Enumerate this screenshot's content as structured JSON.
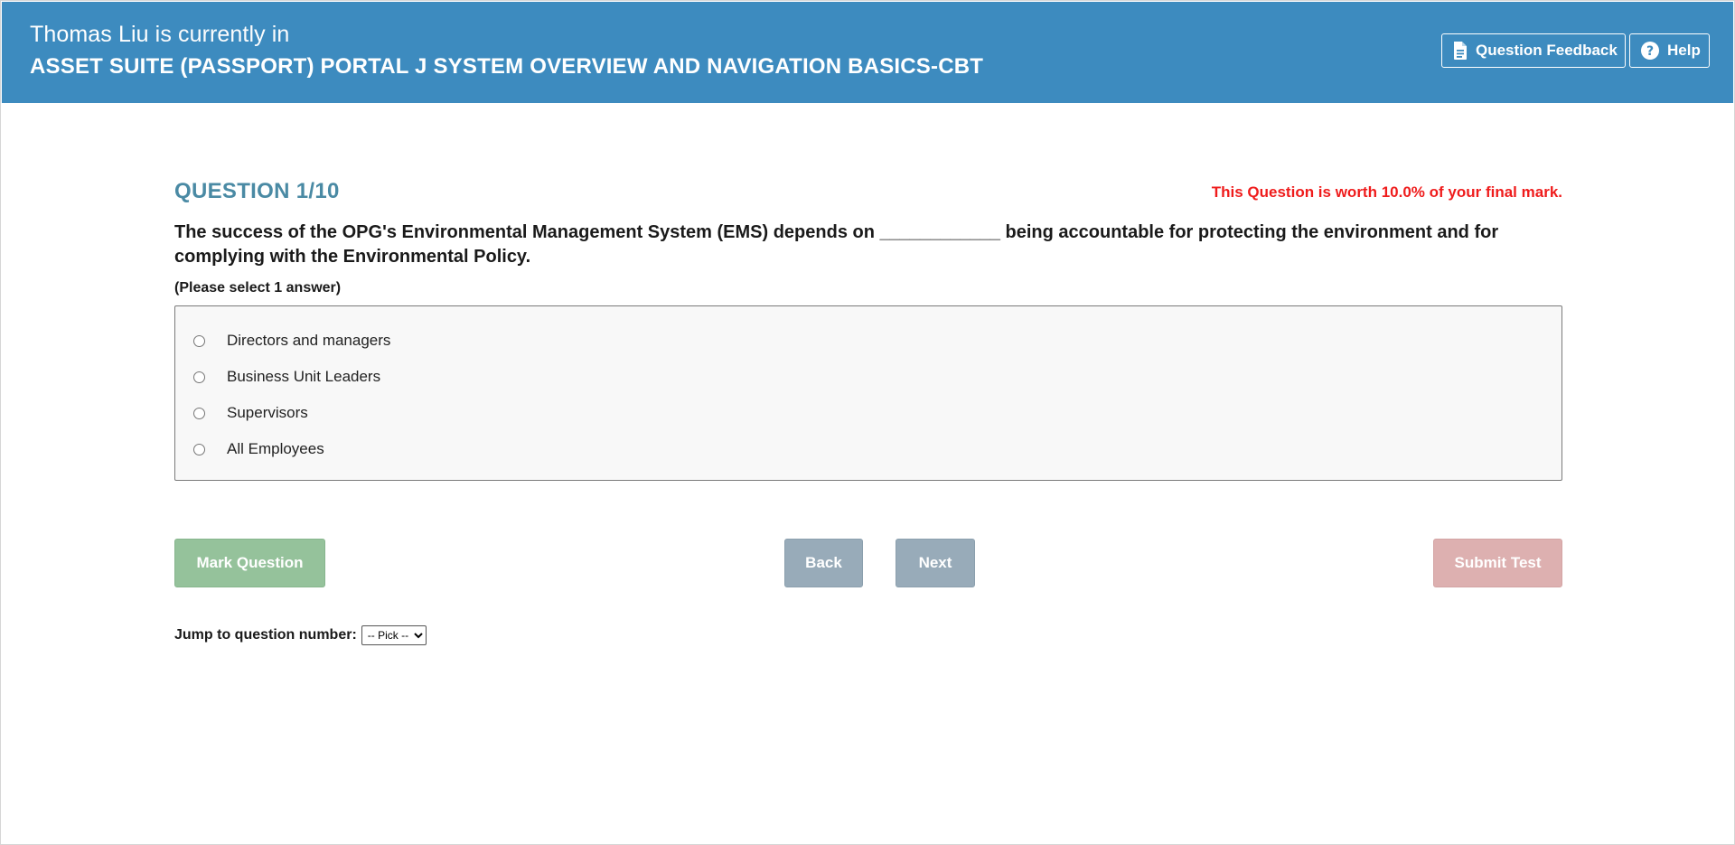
{
  "header": {
    "user_name": "Thomas Liu",
    "status_text": "is currently in",
    "course_title": "ASSET SUITE (PASSPORT) PORTAL J SYSTEM OVERVIEW AND NAVIGATION BASICS-CBT",
    "feedback_label": "Question Feedback",
    "feedback_icon": "document-icon",
    "help_label": "Help",
    "help_icon": "question-circle-icon",
    "bg_color": "#3d8bbf"
  },
  "question": {
    "number_label": "QUESTION 1/10",
    "worth_text": "This Question is worth 10.0% of your final mark.",
    "text": "The success of the OPG's Environmental Management System (EMS) depends on ____________ being accountable for protecting the environment and for complying with the Environmental Policy.",
    "instruction": "(Please select 1 answer)",
    "answers": [
      {
        "label": "Directors and managers",
        "selected": false
      },
      {
        "label": "Business Unit Leaders",
        "selected": false
      },
      {
        "label": "Supervisors",
        "selected": false
      },
      {
        "label": "All Employees",
        "selected": false
      }
    ]
  },
  "actions": {
    "mark_label": "Mark Question",
    "back_label": "Back",
    "next_label": "Next",
    "submit_label": "Submit Test"
  },
  "jump": {
    "label": "Jump to question number:",
    "selected": "-- Pick --"
  },
  "colors": {
    "question_number": "#4a8aa4",
    "worth_text": "#ef1c1c",
    "mark_button": "#95c29b",
    "nav_button": "#98abb9",
    "submit_button": "#ddb0b0"
  }
}
